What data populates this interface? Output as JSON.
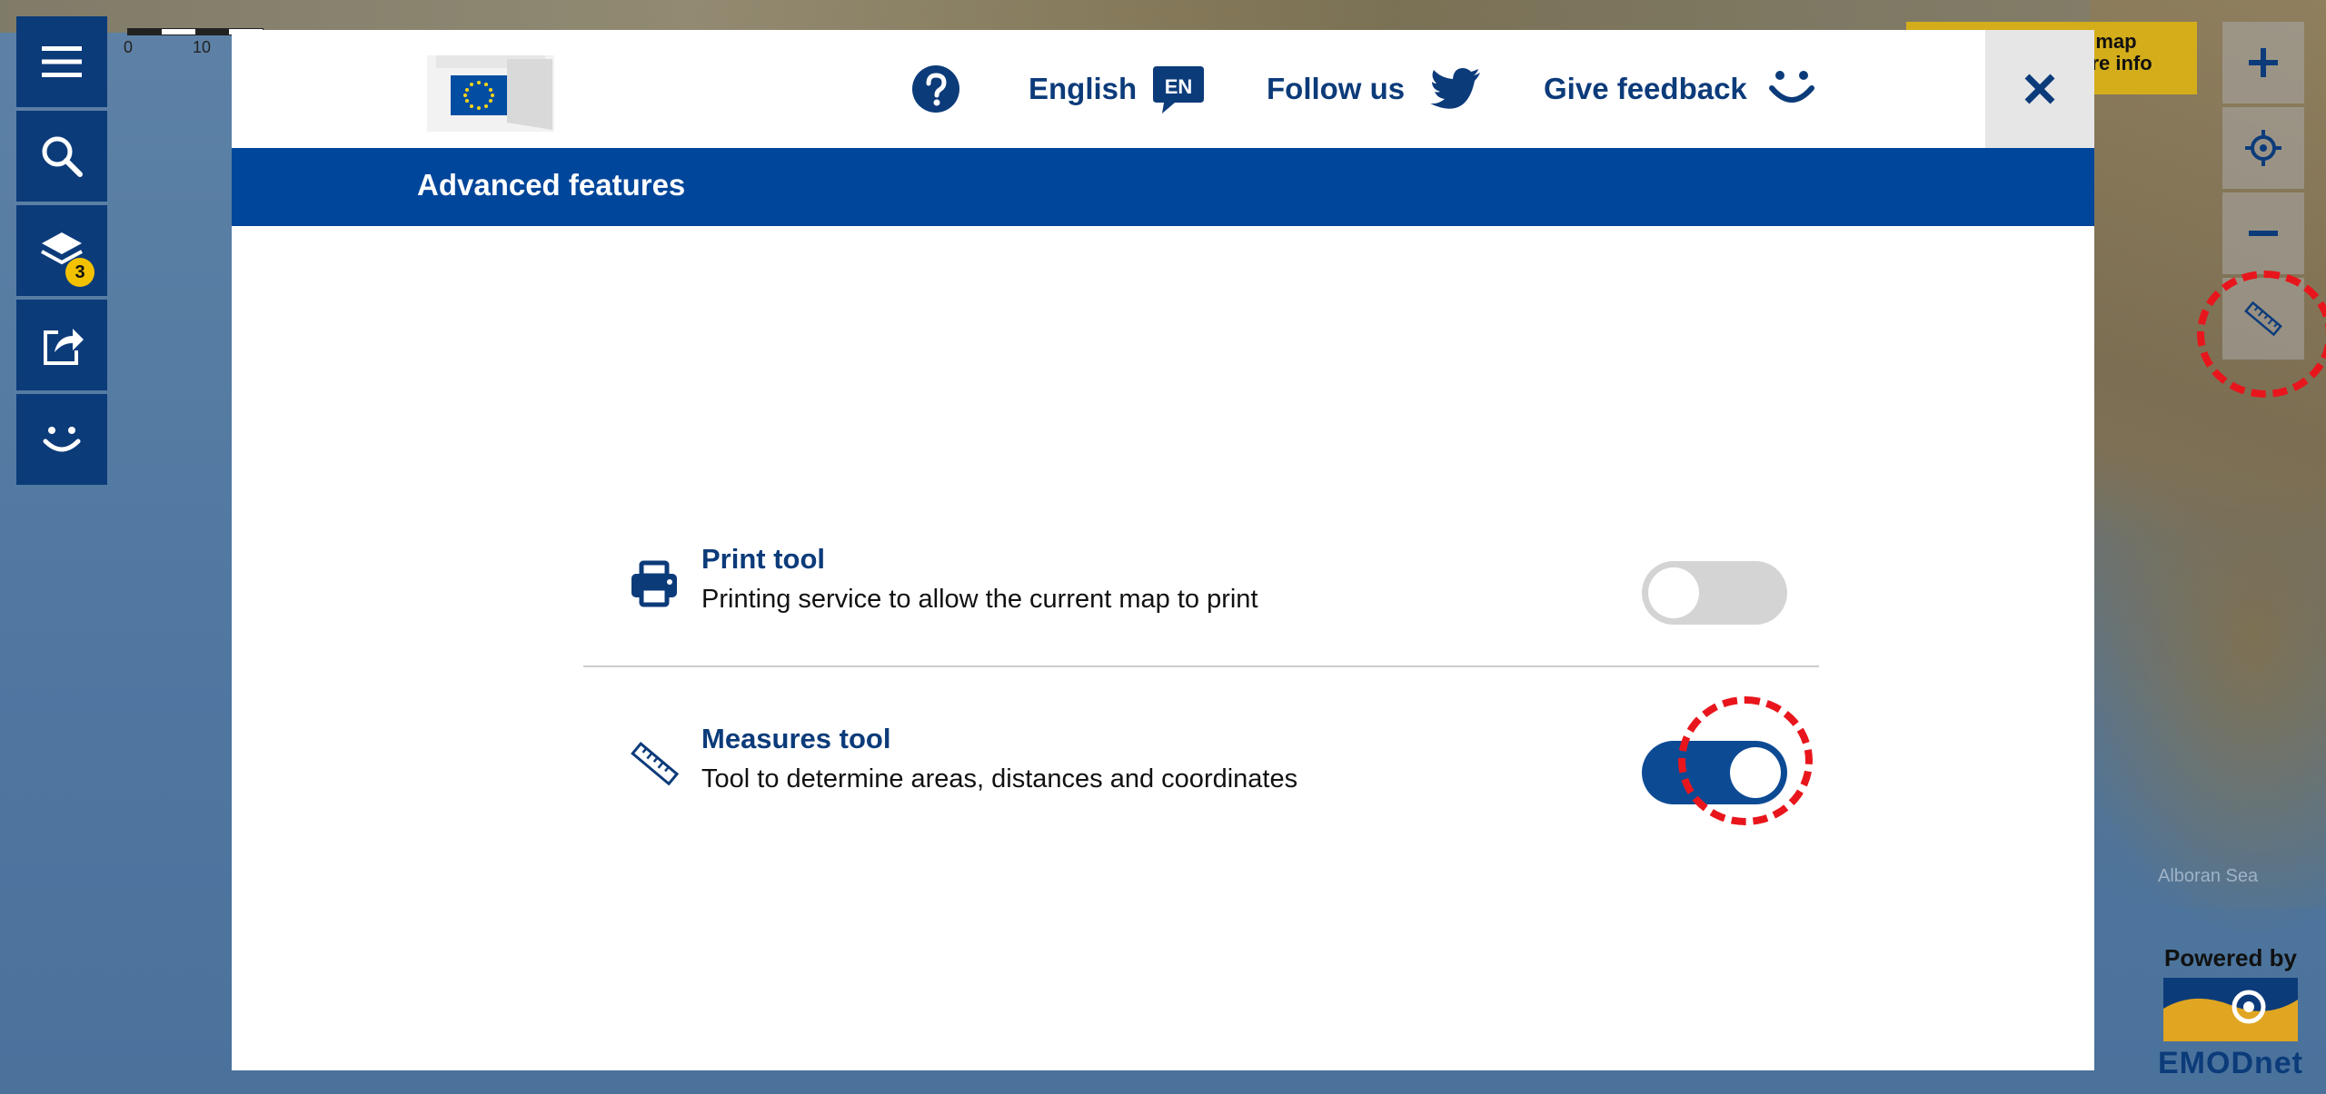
{
  "map": {
    "scale_labels": [
      "0",
      "10"
    ],
    "sea_label": "Alboran Sea",
    "info_box_lines": [
      "e map",
      "ure info"
    ],
    "powered_by": "Powered by",
    "emodnet": "EMODnet"
  },
  "left_toolbar": {
    "items": [
      {
        "name": "menu",
        "icon": "hamburger-menu-icon"
      },
      {
        "name": "search",
        "icon": "search-icon"
      },
      {
        "name": "layers",
        "icon": "layers-icon",
        "badge": "3"
      },
      {
        "name": "share",
        "icon": "share-icon"
      },
      {
        "name": "feedback",
        "icon": "smiley-icon"
      }
    ]
  },
  "right_controls": {
    "items": [
      {
        "name": "zoom-in",
        "icon": "plus-icon"
      },
      {
        "name": "locate",
        "icon": "crosshair-icon"
      },
      {
        "name": "zoom-out",
        "icon": "minus-icon"
      },
      {
        "name": "measure",
        "icon": "ruler-icon"
      }
    ]
  },
  "dialog": {
    "header": {
      "help_icon": "question-circle-icon",
      "language_label": "English",
      "language_code": "EN",
      "follow_label": "Follow us",
      "follow_icon": "twitter-icon",
      "feedback_label": "Give feedback",
      "feedback_icon": "smiley-icon",
      "close_icon": "close-icon"
    },
    "title": "Advanced features",
    "features": [
      {
        "name": "Print tool",
        "description": "Printing service to allow the current map to print",
        "icon": "printer-icon",
        "enabled": false
      },
      {
        "name": "Measures tool",
        "description": "Tool to determine areas, distances and coordinates",
        "icon": "ruler-icon",
        "enabled": true
      }
    ]
  },
  "colors": {
    "eu_blue": "#00469a",
    "dark_blue": "#0c3b7a",
    "toggle_off": "#d4d4d4",
    "highlight_red": "#e8161c",
    "badge_yellow": "#f2c200"
  }
}
